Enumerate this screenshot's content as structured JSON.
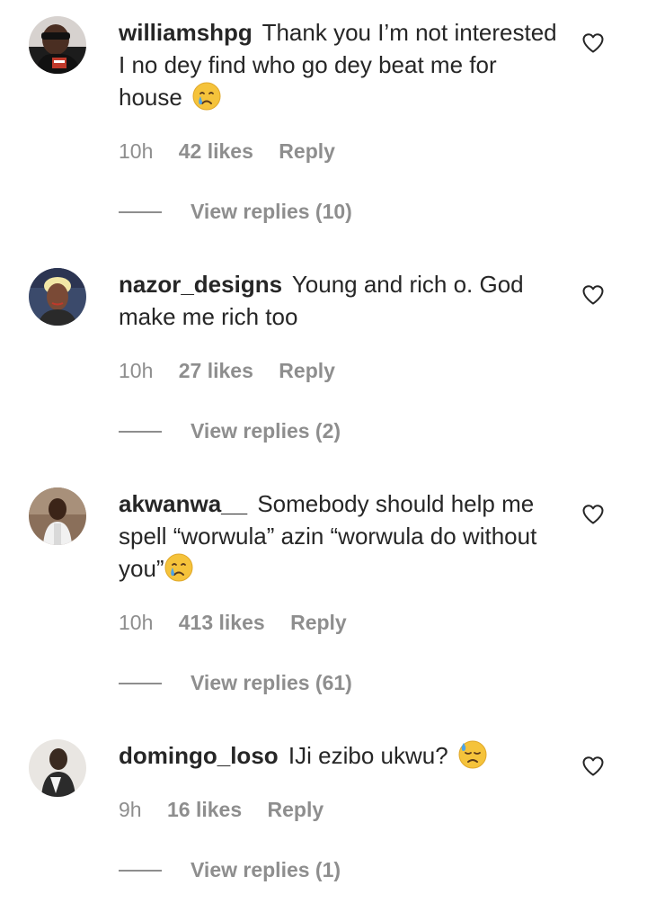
{
  "comments": [
    {
      "username": "williamshpg",
      "text": "Thank you I’m not interested I no dey find who go dey beat me for house",
      "emoji": "crying-face-emoji",
      "time": "10h",
      "likes": "42 likes",
      "reply": "Reply",
      "view_replies": "View replies (10)"
    },
    {
      "username": "nazor_designs",
      "text": "Young and rich o. God make me rich too",
      "time": "10h",
      "likes": "27 likes",
      "reply": "Reply",
      "view_replies": "View replies (2)"
    },
    {
      "username": "akwanwa__",
      "text": "Somebody should help me spell “worwula” azin “worwula do without you”",
      "emoji": "crying-face-emoji",
      "time": "10h",
      "likes": "413 likes",
      "reply": "Reply",
      "view_replies": "View replies (61)"
    },
    {
      "username": "domingo_loso",
      "text": "IJi ezibo ukwu?",
      "emoji": "downcast-face-with-sweat-emoji",
      "time": "9h",
      "likes": "16 likes",
      "reply": "Reply",
      "view_replies": "View replies (1)"
    }
  ],
  "colors": {
    "text": "#262626",
    "secondary": "#8e8e8e",
    "background": "#ffffff"
  },
  "icons": {
    "like": "heart-outline-icon"
  }
}
